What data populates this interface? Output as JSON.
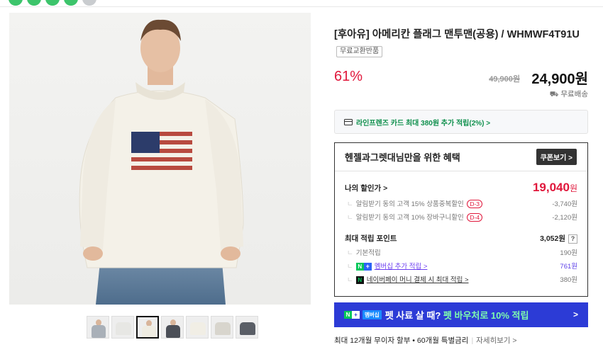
{
  "product": {
    "title": "[후아유] 아메리칸 플래그 맨투맨(공용) / WHMWF4T91U",
    "badge": "무료교환반품",
    "discount": "61%",
    "original_price": "49,900원",
    "sale_price": "24,900원",
    "shipping": "무료배송"
  },
  "card_promo": {
    "text": "라인프렌즈 카드 최대 380원 추가 적립(2%) >"
  },
  "benefit": {
    "title": "헨젤과그렛대님만을 위한 혜택",
    "coupon_button": "쿠폰보기 >",
    "my_discount_label": "나의 할인가 >",
    "my_discount_value": "19,040",
    "my_discount_unit": "원",
    "discounts": [
      {
        "label": "알림받기 동의 고객 15% 상품중복할인",
        "tag": "D-3",
        "value": "-3,740원"
      },
      {
        "label": "알림받기 동의 고객 10% 장바구니할인",
        "tag": "D-4",
        "value": "-2,120원"
      }
    ],
    "points_label": "최대 적립 포인트",
    "points_value": "3,052원",
    "points_help": "?",
    "points": [
      {
        "label": "기본적립",
        "value": "190원"
      },
      {
        "label": "멤버십 추가 적립 >",
        "value": "761원"
      },
      {
        "label": "네이버페이 머니 결제 시 최대 적립 >",
        "value": "380원"
      }
    ]
  },
  "banner": {
    "membership_label": "멤버십",
    "text_prefix": "펫 사료 살 때?",
    "text_highlight": "펫 바우처로 10% 적립",
    "arrow": ">"
  },
  "installment": {
    "text": "최대 12개월 무이자 할부 • 60개월 특별금리",
    "more": "자세히보기 >"
  },
  "colors": {
    "accent_red": "#e0173b",
    "naver_green": "#03c75a",
    "banner_blue": "#2c3bd6"
  }
}
